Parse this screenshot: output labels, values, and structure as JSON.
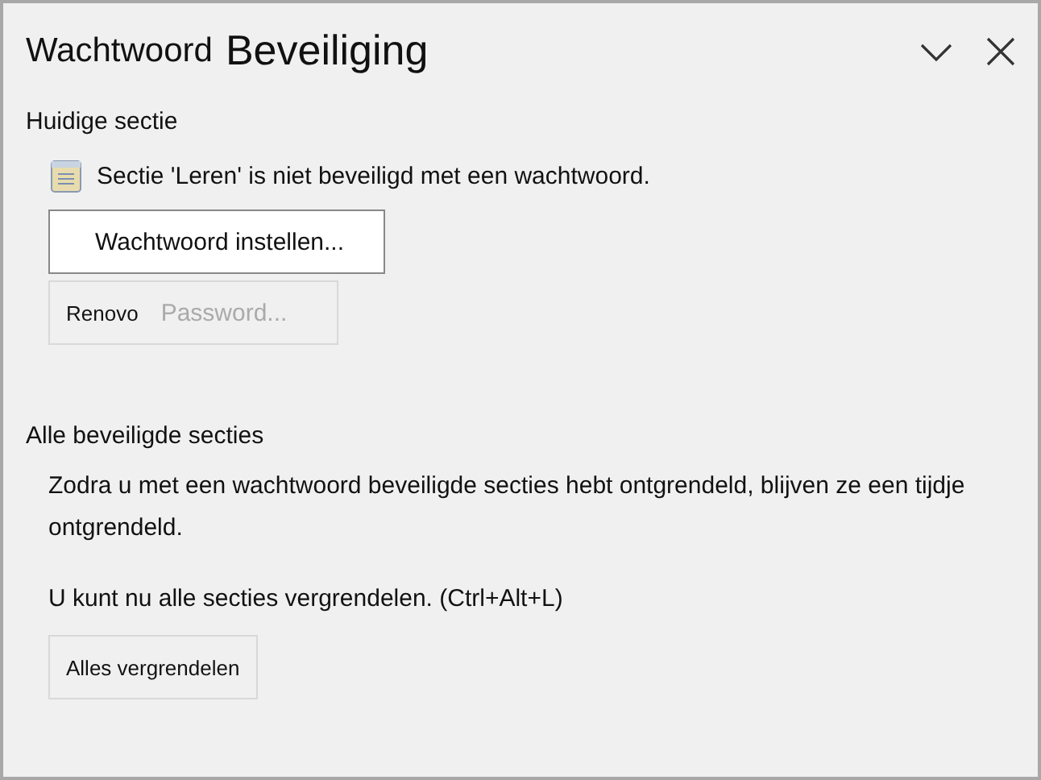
{
  "pane": {
    "title_parts": [
      "Wachtwoord",
      "Beveiliging"
    ]
  },
  "current_section": {
    "heading": "Huidige sectie",
    "status": "Sectie 'Leren' is niet beveiligd met een wachtwoord.",
    "buttons": [
      {
        "label": "Wachtwoord instellen...",
        "disabled": false
      },
      {
        "prefix": "Renovo",
        "label": "Password...",
        "disabled": true
      }
    ]
  },
  "all_sections": {
    "heading": "Alle beveiligde secties",
    "description": "Zodra u met een wachtwoord beveiligde secties hebt ontgrendeld, blijven ze een tijdje ontgrendeld.",
    "hint": "U kunt nu alle secties vergrendelen. (Ctrl+Alt+L)",
    "button": {
      "label": "Alles vergrendelen",
      "disabled": false
    }
  }
}
